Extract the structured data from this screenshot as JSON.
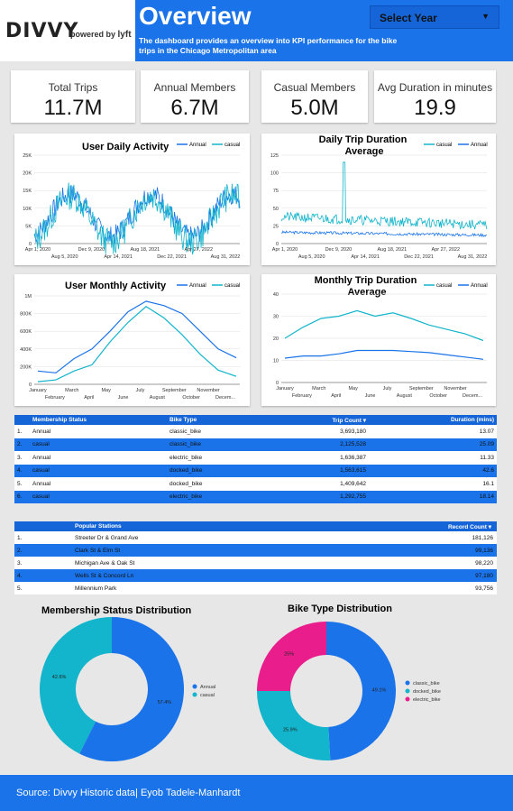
{
  "header": {
    "logo": "DIVVY",
    "powered_by": "powered by",
    "powered_brand": "lyft",
    "title": "Overview",
    "subtitle": "The dashboard provides an overview into KPI performance for the bike trips in the Chicago Metropolitan area",
    "year_select": "Select Year"
  },
  "kpis": [
    {
      "label": "Total Trips",
      "value": "11.7M"
    },
    {
      "label": "Annual Members",
      "value": "6.7M"
    },
    {
      "label": "Casual Members",
      "value": "5.0M"
    },
    {
      "label": "Avg Duration in minutes",
      "value": "19.9"
    }
  ],
  "colors": {
    "annual": "#1a73e8",
    "casual": "#12b5cb",
    "pink": "#e91e8c",
    "header": "#1a73e8"
  },
  "chart_data": [
    {
      "type": "line",
      "title": "User Daily Activity",
      "legend": [
        "Annual",
        "casual"
      ],
      "y_ticks": [
        "0",
        "5K",
        "10K",
        "15K",
        "20K",
        "25K"
      ],
      "x_ticks_top": [
        "Apr 1, 2020",
        "Dec 9, 2020",
        "Aug 18, 2021",
        "Apr 27, 2022"
      ],
      "x_ticks_bottom": [
        "Aug 5, 2020",
        "Apr 14, 2021",
        "Dec 22, 2021",
        "Aug 31, 2022"
      ],
      "ylim": [
        0,
        25000
      ]
    },
    {
      "type": "line",
      "title": "Daily Trip Duration Average",
      "legend": [
        "casual",
        "Annual"
      ],
      "y_ticks": [
        "0",
        "25",
        "50",
        "75",
        "100",
        "125"
      ],
      "x_ticks_top": [
        "Apr 1, 2020",
        "Dec 9, 2020",
        "Aug 18, 2021",
        "Apr 27, 2022"
      ],
      "x_ticks_bottom": [
        "Aug 5, 2020",
        "Apr 14, 2021",
        "Dec 22, 2021",
        "Aug 31, 2022"
      ],
      "ylim": [
        0,
        125
      ]
    },
    {
      "type": "line",
      "title": "User Monthly Activity",
      "legend": [
        "Annual",
        "casual"
      ],
      "y_ticks": [
        "0",
        "200K",
        "400K",
        "600K",
        "800K",
        "1M"
      ],
      "x_ticks_top": [
        "January",
        "March",
        "May",
        "July",
        "September",
        "November"
      ],
      "x_ticks_bottom": [
        "February",
        "April",
        "June",
        "August",
        "October",
        "Decem..."
      ],
      "ylim": [
        0,
        1000000
      ],
      "series": [
        {
          "name": "Annual",
          "values": [
            150000,
            130000,
            290000,
            400000,
            600000,
            820000,
            940000,
            890000,
            800000,
            600000,
            400000,
            300000
          ]
        },
        {
          "name": "casual",
          "values": [
            30000,
            50000,
            150000,
            220000,
            480000,
            700000,
            880000,
            750000,
            560000,
            340000,
            160000,
            90000
          ]
        }
      ]
    },
    {
      "type": "line",
      "title": "Monthly Trip Duration Average",
      "legend": [
        "casual",
        "Annual"
      ],
      "y_ticks": [
        "0",
        "10",
        "20",
        "30",
        "40"
      ],
      "x_ticks_top": [
        "January",
        "March",
        "May",
        "July",
        "September",
        "November"
      ],
      "x_ticks_bottom": [
        "February",
        "April",
        "June",
        "August",
        "October",
        "Decem..."
      ],
      "ylim": [
        0,
        40
      ],
      "series": [
        {
          "name": "casual",
          "values": [
            20,
            25,
            29,
            30,
            32.5,
            30,
            31.5,
            29,
            26,
            24,
            22,
            19
          ]
        },
        {
          "name": "Annual",
          "values": [
            11,
            12,
            12,
            13,
            14.5,
            14.5,
            14.5,
            14,
            13.5,
            12.5,
            11.5,
            10.5
          ]
        }
      ]
    },
    {
      "type": "pie",
      "title": "Membership Status Distribution",
      "labels": [
        "Annual",
        "casual"
      ],
      "values": [
        57.4,
        42.6
      ],
      "value_labels": [
        "57.4%",
        "42.6%"
      ]
    },
    {
      "type": "pie",
      "title": "Bike Type Distribution",
      "labels": [
        "classic_bike",
        "docked_bike",
        "electric_bike"
      ],
      "values": [
        49.1,
        25.9,
        25
      ],
      "value_labels": [
        "49.1%",
        "25.9%",
        "25%"
      ]
    }
  ],
  "membership_table": {
    "headers": [
      "Membership Status",
      "Bike Type",
      "Trip Count ▾",
      "Duration (mins)"
    ],
    "rows": [
      {
        "n": "1.",
        "status": "Annual",
        "bike": "classic_bike",
        "count": "3,693,180",
        "dur": "13.07"
      },
      {
        "n": "2.",
        "status": "casual",
        "bike": "classic_bike",
        "count": "2,125,528",
        "dur": "25.09"
      },
      {
        "n": "3.",
        "status": "Annual",
        "bike": "electric_bike",
        "count": "1,636,387",
        "dur": "11.33"
      },
      {
        "n": "4.",
        "status": "casual",
        "bike": "docked_bike",
        "count": "1,563,615",
        "dur": "42.6"
      },
      {
        "n": "5.",
        "status": "Annual",
        "bike": "docked_bike",
        "count": "1,409,642",
        "dur": "16.1"
      },
      {
        "n": "6.",
        "status": "casual",
        "bike": "electric_bike",
        "count": "1,292,755",
        "dur": "18.14"
      }
    ]
  },
  "stations_table": {
    "headers": [
      "Popular Stations",
      "Record Count ▾"
    ],
    "rows": [
      {
        "n": "1.",
        "name": "Streeter Dr & Grand Ave",
        "count": "181,126"
      },
      {
        "n": "2.",
        "name": "Clark St & Elm St",
        "count": "99,136"
      },
      {
        "n": "3.",
        "name": "Michigan Ave & Oak St",
        "count": "98,220"
      },
      {
        "n": "4.",
        "name": "Wells St & Concord Ln",
        "count": "97,180"
      },
      {
        "n": "5.",
        "name": "Millennium Park",
        "count": "93,756"
      }
    ]
  },
  "footer": {
    "text": "Source: Divvy Historic data| Eyob Tadele-Manhardt"
  }
}
